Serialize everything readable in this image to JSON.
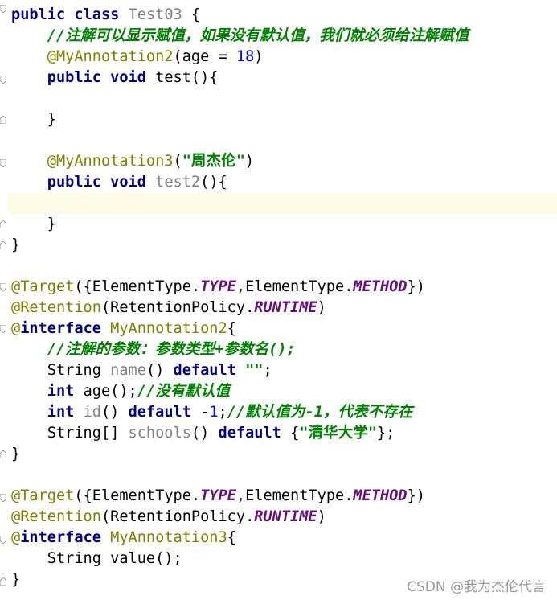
{
  "code": {
    "l1": [
      "public",
      "class",
      "Test03",
      "{"
    ],
    "l2": "//注解可以显示赋值，如果没有默认值，我们就必须给注解赋值",
    "l3": [
      "@MyAnnotation2",
      "(age = ",
      "18",
      ")"
    ],
    "l4": [
      "public",
      "void",
      "test(){"
    ],
    "l6": "}",
    "l8": [
      "@MyAnnotation3",
      "(",
      "\"周杰伦\"",
      ")"
    ],
    "l9": [
      "public",
      "void",
      "test2",
      "(){"
    ],
    "l11": "}",
    "l12": "}",
    "l14": [
      "@Target",
      "({ElementType.",
      "TYPE",
      ",ElementType.",
      "METHOD",
      "})"
    ],
    "l15": [
      "@Retention",
      "(RetentionPolicy.",
      "RUNTIME",
      ")"
    ],
    "l16": [
      "@",
      "interface",
      "MyAnnotation2",
      "{"
    ],
    "l17": "//注解的参数：参数类型+参数名();",
    "l18": [
      "String ",
      "name",
      "() ",
      "default",
      " ",
      "\"\"",
      ";"
    ],
    "l19": [
      "int",
      " age();",
      "//没有默认值"
    ],
    "l20": [
      "int",
      " ",
      "id",
      "() ",
      "default",
      " -",
      "1",
      ";",
      "//默认值为-1，代表不存在"
    ],
    "l21": [
      "String[] ",
      "schools",
      "() ",
      "default",
      " {",
      "\"清华大学\"",
      "};"
    ],
    "l22": "}",
    "l24": [
      "@Target",
      "({ElementType.",
      "TYPE",
      ",ElementType.",
      "METHOD",
      "})"
    ],
    "l25": [
      "@Retention",
      "(RetentionPolicy.",
      "RUNTIME",
      ")"
    ],
    "l26": [
      "@",
      "interface",
      "MyAnnotation3",
      "{"
    ],
    "l27": "String value();",
    "l28": "}"
  },
  "watermark": "CSDN @我为杰伦代言",
  "colors": {
    "keyword": "#000080",
    "annotation": "#808000",
    "comment": "#008000",
    "number": "#0000ff",
    "field": "#660e7a",
    "highlight_line": "#fdfbe6"
  }
}
